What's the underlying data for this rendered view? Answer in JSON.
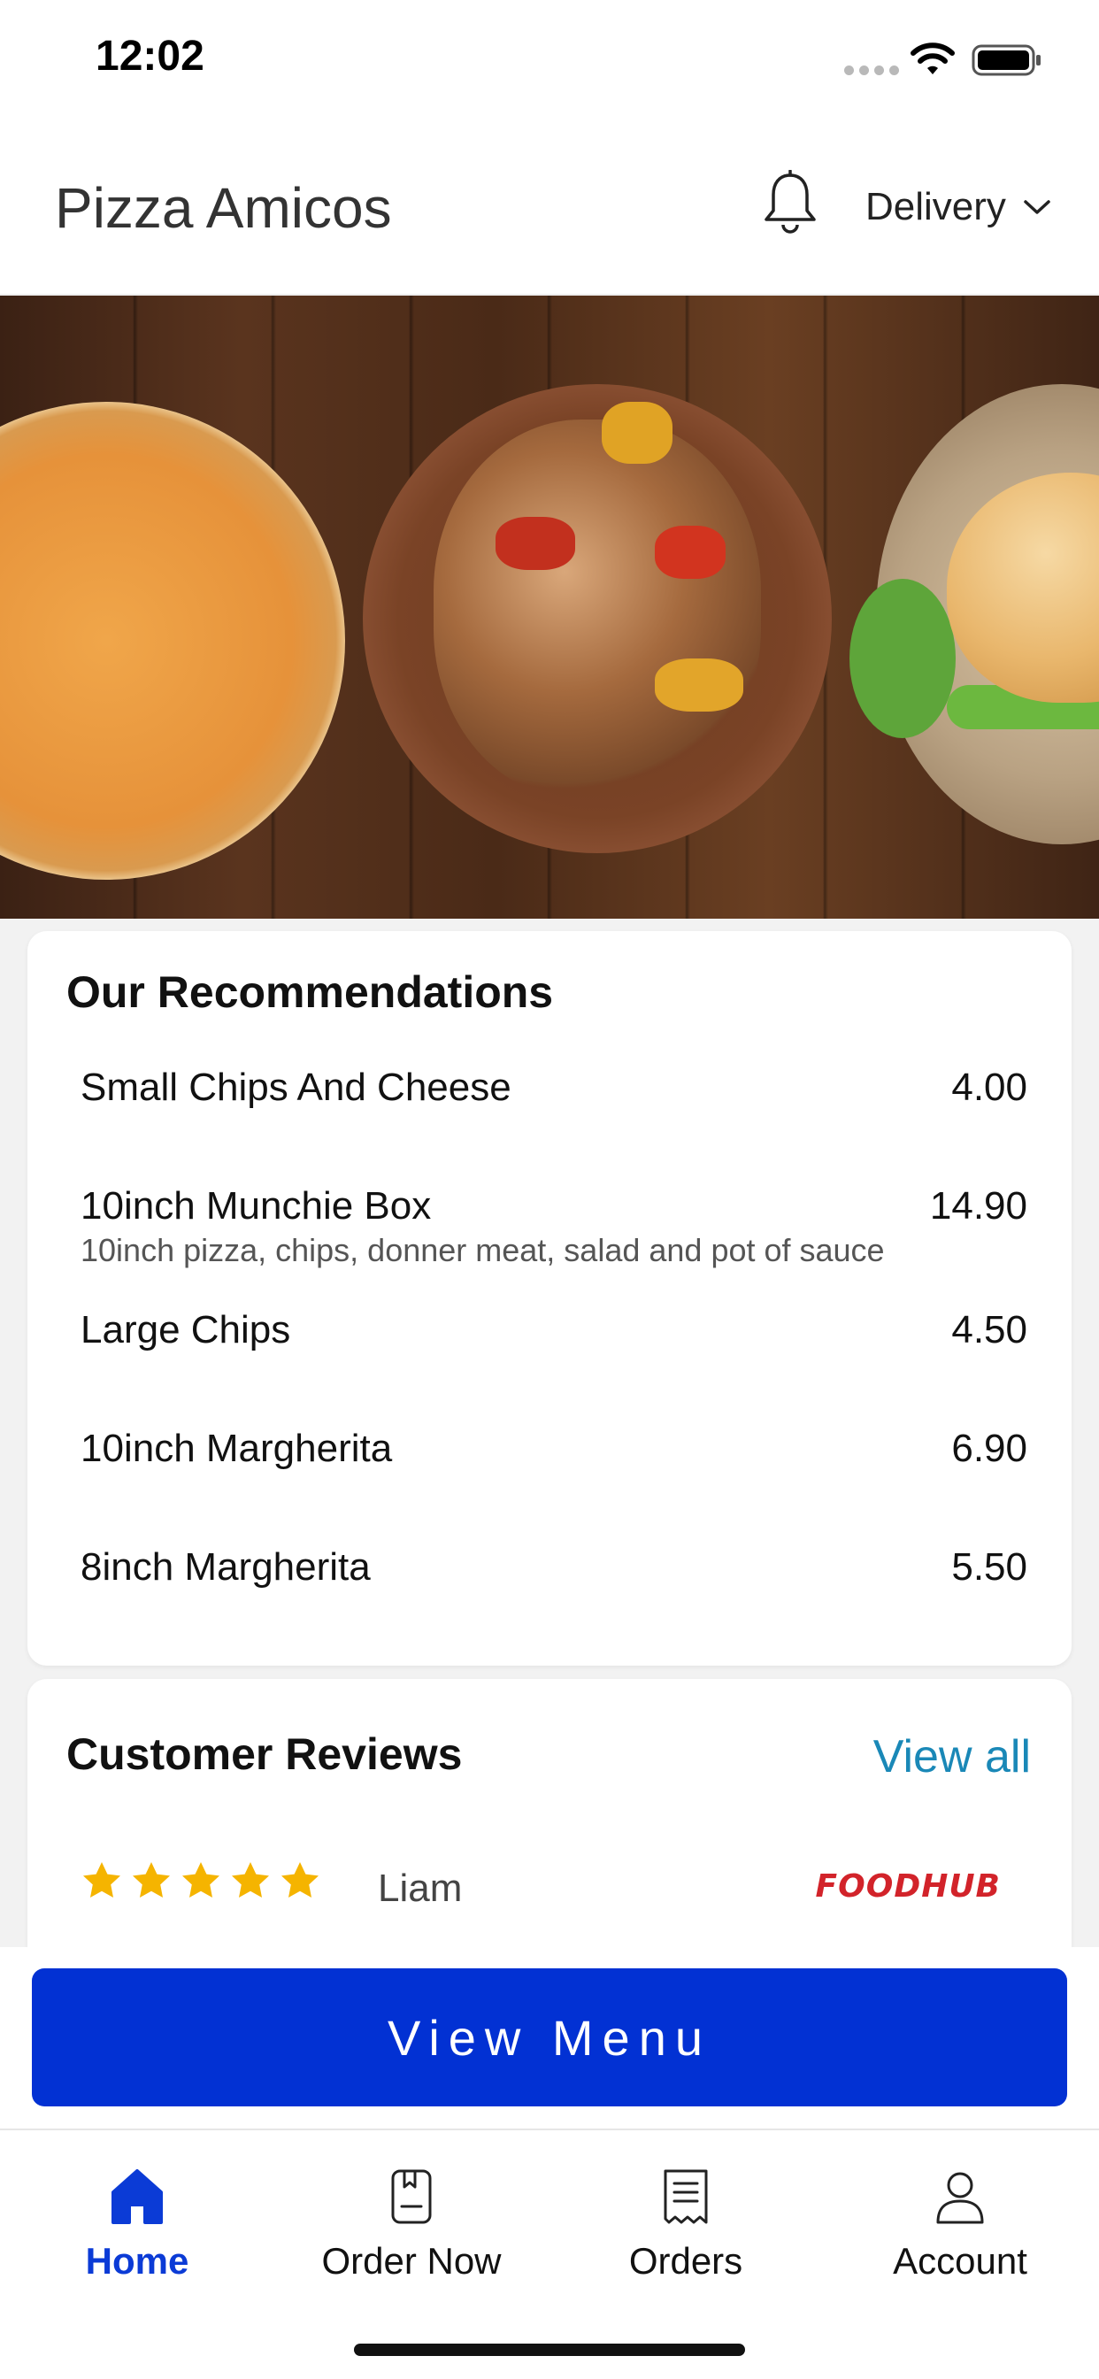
{
  "status_bar": {
    "time": "12:02"
  },
  "header": {
    "store_name": "Pizza Amicos",
    "order_mode": "Delivery",
    "icons": [
      "bell-icon",
      "chevron-down-icon"
    ]
  },
  "hero": {
    "image_subject": "pizza, chicken skewers and burger on wooden table"
  },
  "recommendations": {
    "title": "Our Recommendations",
    "items": [
      {
        "name": "Small Chips And Cheese",
        "price": "4.00",
        "description": ""
      },
      {
        "name": "10inch Munchie Box",
        "price": "14.90",
        "description": "10inch pizza, chips, donner meat, salad and pot of sauce"
      },
      {
        "name": "Large Chips",
        "price": "4.50",
        "description": ""
      },
      {
        "name": "10inch Margherita",
        "price": "6.90",
        "description": ""
      },
      {
        "name": "8inch Margherita",
        "price": "5.50",
        "description": ""
      }
    ]
  },
  "reviews": {
    "title": "Customer Reviews",
    "view_all": "View all",
    "items": [
      {
        "rating": 5,
        "reviewer": "Liam",
        "source": "FOODHUB"
      }
    ],
    "star_color": "#f5b400"
  },
  "cta": {
    "label": "View Menu",
    "color": "#0231d3"
  },
  "bottom_nav": {
    "items": [
      {
        "label": "Home",
        "icon": "home-icon",
        "active": true
      },
      {
        "label": "Order Now",
        "icon": "menu-book-icon",
        "active": false
      },
      {
        "label": "Orders",
        "icon": "receipt-icon",
        "active": false
      },
      {
        "label": "Account",
        "icon": "user-icon",
        "active": false
      }
    ],
    "active_color": "#0b3bd6"
  }
}
